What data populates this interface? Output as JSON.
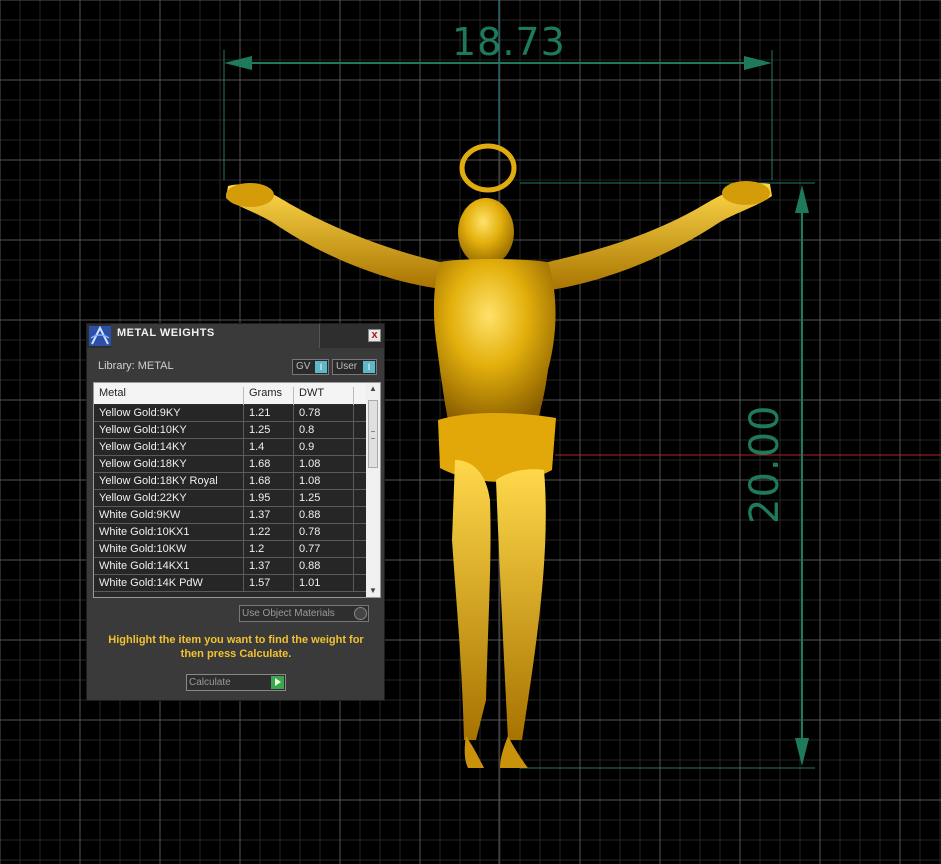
{
  "viewport": {
    "dimension_horizontal": "18.73",
    "dimension_vertical": "20.00"
  },
  "colors": {
    "grid_major": "#555555",
    "grid_minor": "#262626",
    "dimension": "#1f7a5a",
    "gold": "#e3b00c",
    "axis_red": "#b42018",
    "axis_cyan": "#3a8ea0",
    "hint": "#f2c230"
  },
  "panel": {
    "title": "METAL WEIGHTS",
    "close": "x",
    "library_label": "Library: METAL",
    "chip_gv": "GV",
    "chip_user": "User",
    "columns": [
      "Metal",
      "Grams",
      "DWT"
    ],
    "rows": [
      {
        "metal": "Yellow Gold:9KY",
        "grams": "1.21",
        "dwt": "0.78"
      },
      {
        "metal": "Yellow Gold:10KY",
        "grams": "1.25",
        "dwt": "0.8"
      },
      {
        "metal": "Yellow Gold:14KY",
        "grams": "1.4",
        "dwt": "0.9"
      },
      {
        "metal": "Yellow Gold:18KY",
        "grams": "1.68",
        "dwt": "1.08"
      },
      {
        "metal": "Yellow Gold:18KY Royal",
        "grams": "1.68",
        "dwt": "1.08"
      },
      {
        "metal": "Yellow Gold:22KY",
        "grams": "1.95",
        "dwt": "1.25"
      },
      {
        "metal": "White Gold:9KW",
        "grams": "1.37",
        "dwt": "0.88"
      },
      {
        "metal": "White Gold:10KX1",
        "grams": "1.22",
        "dwt": "0.78"
      },
      {
        "metal": "White Gold:10KW",
        "grams": "1.2",
        "dwt": "0.77"
      },
      {
        "metal": "White Gold:14KX1",
        "grams": "1.37",
        "dwt": "0.88"
      },
      {
        "metal": "White Gold:14K PdW",
        "grams": "1.57",
        "dwt": "1.01"
      }
    ],
    "use_object_materials": "Use Object Materials",
    "hint": "Highlight the item you want to find the weight for then press Calculate.",
    "calculate": "Calculate"
  }
}
